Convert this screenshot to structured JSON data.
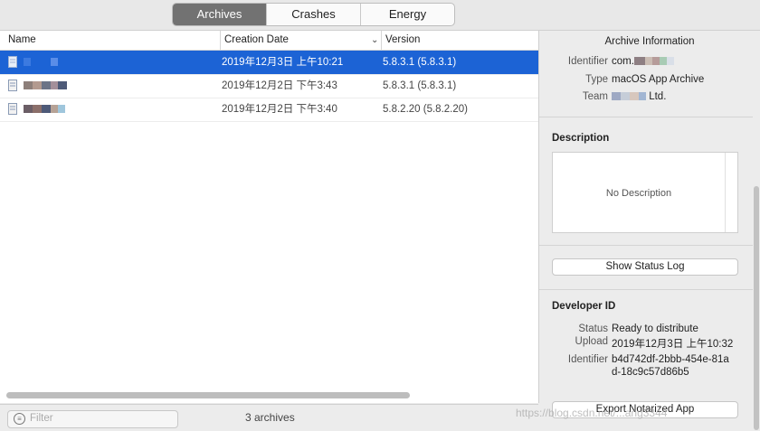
{
  "tabs": [
    {
      "label": "Archives",
      "active": true
    },
    {
      "label": "Crashes",
      "active": false
    },
    {
      "label": "Energy",
      "active": false
    }
  ],
  "table": {
    "columns": {
      "name": "Name",
      "date": "Creation Date",
      "version": "Version"
    },
    "rows": [
      {
        "date": "2019年12月3日 上午10:21",
        "version": "5.8.3.1 (5.8.3.1)",
        "selected": true
      },
      {
        "date": "2019年12月2日 下午3:43",
        "version": "5.8.3.1 (5.8.3.1)",
        "selected": false
      },
      {
        "date": "2019年12月2日 下午3:40",
        "version": "5.8.2.20 (5.8.2.20)",
        "selected": false
      }
    ]
  },
  "filter": {
    "placeholder": "Filter"
  },
  "status": {
    "count": "3 archives"
  },
  "info": {
    "title": "Archive Information",
    "identifier_label": "Identifier",
    "identifier_prefix": "com.",
    "type_label": "Type",
    "type_value": "macOS App Archive",
    "team_label": "Team",
    "team_suffix": "Ltd."
  },
  "description": {
    "heading": "Description",
    "empty_text": "No Description"
  },
  "buttons": {
    "show_status_log": "Show Status Log",
    "export_notarized": "Export Notarized App"
  },
  "developer_id": {
    "heading": "Developer ID",
    "status_label": "Status",
    "status_value": "Ready to distribute",
    "upload_label": "Upload",
    "upload_value": "2019年12月3日 上午10:32",
    "identifier_label": "Identifier",
    "identifier_line1": "b4d742df-2bbb-454e-81a",
    "identifier_line2": "d-18c9c57d86b5"
  },
  "watermark": "https://blog.csdn.net/...ang3344",
  "colors": {
    "selection": "#1c63d5",
    "active_tab": "#727272"
  }
}
